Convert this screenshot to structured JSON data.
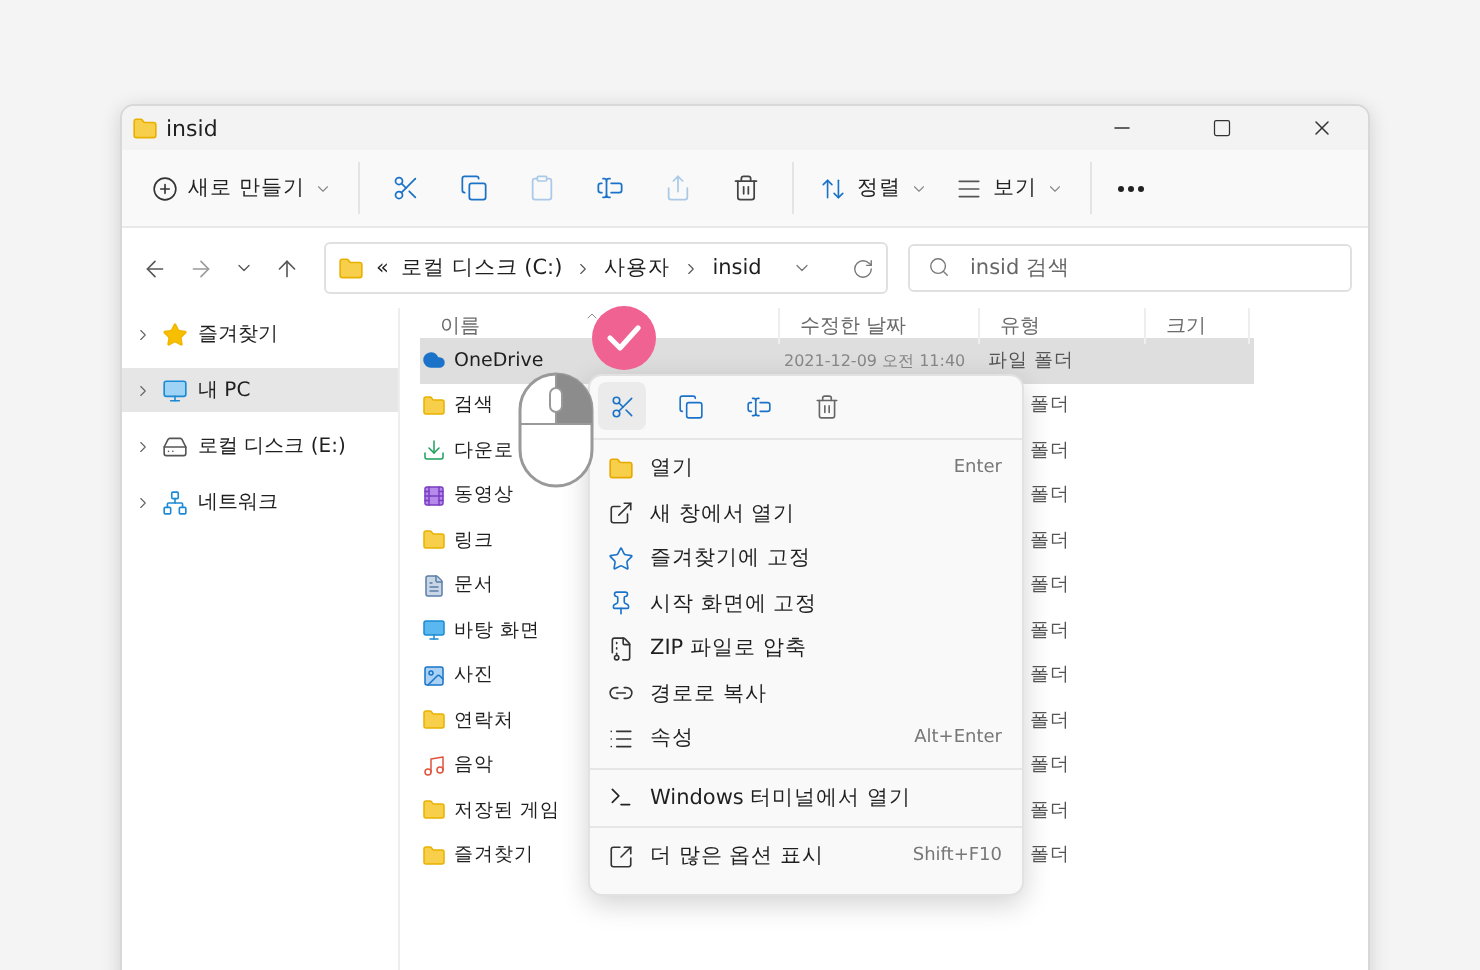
{
  "window": {
    "title": "insid"
  },
  "toolbar": {
    "new_button": {
      "label": "새로 만들기"
    },
    "icon_buttons": [
      {
        "kind": "cut",
        "disabled": false
      },
      {
        "kind": "copy",
        "disabled": false
      },
      {
        "kind": "paste",
        "disabled": true
      },
      {
        "kind": "rename",
        "disabled": false
      },
      {
        "kind": "share",
        "disabled": true
      },
      {
        "kind": "delete",
        "disabled": false
      }
    ],
    "sort_button": {
      "label": "정렬"
    },
    "view_button": {
      "label": "보기"
    }
  },
  "address_bar": {
    "overflow": "«",
    "crumbs": [
      "로컬 디스크 (C:)",
      "사용자",
      "insid"
    ]
  },
  "search": {
    "placeholder": "insid 검색"
  },
  "sidebar": {
    "items": [
      {
        "kind": "star",
        "label": "즐겨찾기",
        "selected": false
      },
      {
        "kind": "pc",
        "label": "내 PC",
        "selected": true
      },
      {
        "kind": "drive",
        "label": "로컬 디스크 (E:)",
        "selected": false
      },
      {
        "kind": "network",
        "label": "네트워크",
        "selected": false
      }
    ]
  },
  "table": {
    "columns": [
      "이름",
      "수정한 날짜",
      "유형",
      "크기"
    ],
    "rows": [
      {
        "kind": "cloud",
        "name": "OneDrive",
        "date": "2021-12-09 오전 11:40",
        "type": "파일 폴더",
        "selected": true
      },
      {
        "kind": "folder",
        "name": "검색",
        "type": "폴더",
        "selected": false
      },
      {
        "kind": "download",
        "name": "다운로",
        "type": "폴더",
        "selected": false
      },
      {
        "kind": "video",
        "name": "동영상",
        "type": "폴더",
        "selected": false
      },
      {
        "kind": "folder",
        "name": "링크",
        "type": "폴더",
        "selected": false
      },
      {
        "kind": "document",
        "name": "문서",
        "type": "폴더",
        "selected": false
      },
      {
        "kind": "desktop",
        "name": "바탕 화면",
        "type": "폴더",
        "selected": false
      },
      {
        "kind": "picture",
        "name": "사진",
        "type": "폴더",
        "selected": false
      },
      {
        "kind": "folder",
        "name": "연락처",
        "type": "폴더",
        "selected": false
      },
      {
        "kind": "music",
        "name": "음악",
        "type": "폴더",
        "selected": false
      },
      {
        "kind": "folder",
        "name": "저장된 게임",
        "type": "폴더",
        "selected": false
      },
      {
        "kind": "folder",
        "name": "즐겨찾기",
        "type": "폴더",
        "selected": false
      }
    ]
  },
  "context_menu": {
    "quick_actions": [
      {
        "kind": "cut",
        "selected": true
      },
      {
        "kind": "copy",
        "selected": false
      },
      {
        "kind": "rename",
        "selected": false
      },
      {
        "kind": "delete",
        "selected": false
      }
    ],
    "groups": [
      [
        {
          "kind": "open",
          "label": "열기",
          "shortcut": "Enter"
        },
        {
          "kind": "new-window",
          "label": "새 창에서 열기"
        },
        {
          "kind": "favorite",
          "label": "즐겨찾기에 고정"
        },
        {
          "kind": "pin",
          "label": "시작 화면에 고정"
        },
        {
          "kind": "zip",
          "label": "ZIP 파일로 압축"
        },
        {
          "kind": "path",
          "label": "경로로 복사"
        },
        {
          "kind": "properties",
          "label": "속성",
          "shortcut": "Alt+Enter"
        }
      ],
      [
        {
          "kind": "terminal",
          "label": "Windows 터미널에서 열기"
        }
      ],
      [
        {
          "kind": "more",
          "label": "더 많은 옵션 표시",
          "shortcut": "Shift+F10"
        }
      ]
    ]
  }
}
